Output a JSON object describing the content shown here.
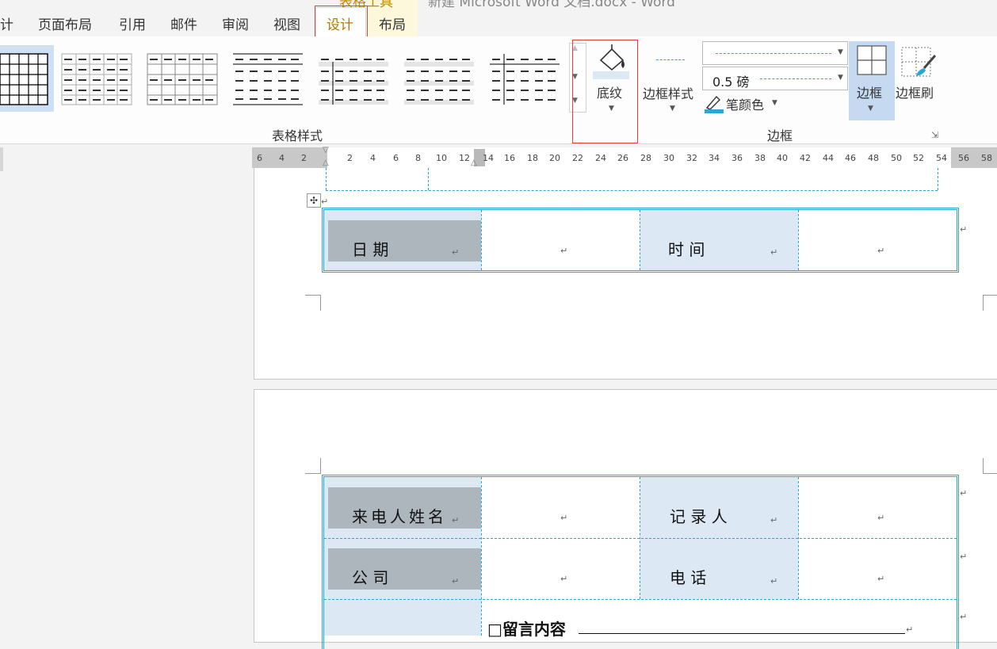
{
  "tabs": {
    "design_partial": "计",
    "page_layout": "页面布局",
    "references": "引用",
    "mailings": "邮件",
    "review": "审阅",
    "view": "视图",
    "design": "设计",
    "layout": "布局"
  },
  "window": {
    "title_partial": "新建 Microsoft Word 文档.docx - Word",
    "context_group": "表格工具"
  },
  "ribbon": {
    "group_table_styles": "表格样式",
    "shading_label": "底纹",
    "border_styles_label": "边框样式",
    "line_weight_value": "0.5 磅",
    "pen_color_label": "笔颜色",
    "borders_label": "边框",
    "border_painter_label": "边框刷",
    "group_borders": "边框"
  },
  "ruler": {
    "ticks": [
      "6",
      "4",
      "2",
      "2",
      "4",
      "6",
      "8",
      "10",
      "12",
      "14",
      "16",
      "18",
      "20",
      "22",
      "24",
      "26",
      "28",
      "30",
      "32",
      "34",
      "36",
      "38",
      "40",
      "42",
      "44",
      "46",
      "48",
      "50",
      "52",
      "54",
      "56",
      "58"
    ]
  },
  "table1": {
    "date_label": "日        期",
    "time_label": "时          间"
  },
  "table2": {
    "caller_name_label": "来电人姓名",
    "recorder_label": "记    录    人",
    "company_label": "公              司",
    "phone_label": "电            话",
    "message_label": "□留言内容"
  },
  "colors": {
    "accent_red": "#d9453b",
    "table_border": "#2aa7d2",
    "shade_blue": "#dde8f5",
    "label_gray": "#adb5bd"
  }
}
